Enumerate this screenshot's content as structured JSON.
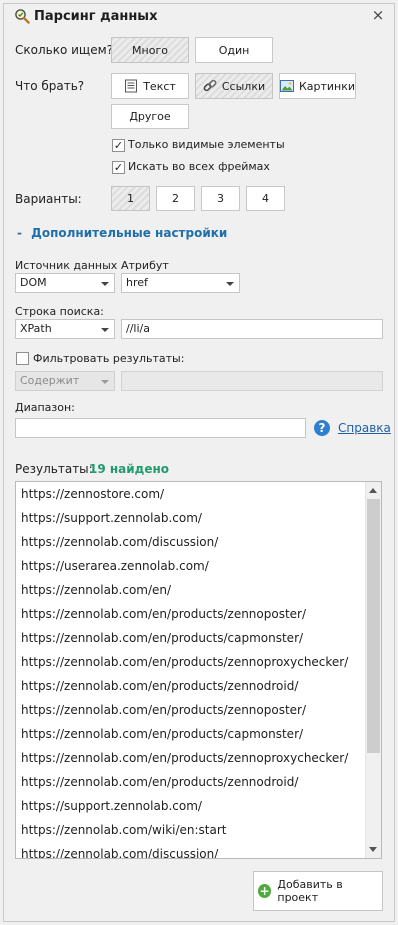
{
  "header": {
    "title": "Парсинг данных",
    "close": "×"
  },
  "search_count": {
    "label": "Сколько ищем?",
    "options": [
      "Много",
      "Один"
    ],
    "selected": "Много"
  },
  "what_take": {
    "label": "Что брать?",
    "options": [
      "Текст",
      "Ссылки",
      "Картинки",
      "Другое"
    ],
    "selected": "Ссылки"
  },
  "checks": [
    {
      "label": "Только видимые элементы",
      "checked": true
    },
    {
      "label": "Искать во всех фреймах",
      "checked": true
    }
  ],
  "variants": {
    "label": "Варианты:",
    "options": [
      "1",
      "2",
      "3",
      "4"
    ],
    "selected": "1"
  },
  "advanced": {
    "toggle": "-",
    "label": "Дополнительные настройки"
  },
  "source": {
    "label": "Источник данных",
    "value": "DOM"
  },
  "attribute": {
    "label": "Атрибут",
    "value": "href"
  },
  "query": {
    "label": "Строка поиска:",
    "type": "XPath",
    "value": "//li/a"
  },
  "filter": {
    "label": "Фильтровать результаты:",
    "checked": false,
    "mode": "Содержит",
    "value": ""
  },
  "range": {
    "label": "Диапазон:",
    "value": "",
    "help_link": "Справка"
  },
  "results": {
    "label": "Результаты:",
    "count_text": "19 найдено",
    "items": [
      "https://zennostore.com/",
      "https://support.zennolab.com/",
      "https://zennolab.com/discussion/",
      "https://userarea.zennolab.com/",
      "https://zennolab.com/en/",
      "https://zennolab.com/en/products/zennoposter/",
      "https://zennolab.com/en/products/capmonster/",
      "https://zennolab.com/en/products/zennoproxychecker/",
      "https://zennolab.com/en/products/zennodroid/",
      "https://zennolab.com/en/products/zennoposter/",
      "https://zennolab.com/en/products/capmonster/",
      "https://zennolab.com/en/products/zennoproxychecker/",
      "https://zennolab.com/en/products/zennodroid/",
      "https://support.zennolab.com/",
      "https://zennolab.com/wiki/en:start",
      "https://zennolab.com/discussion/"
    ]
  },
  "footer": {
    "add_label": "Добавить в проект"
  }
}
